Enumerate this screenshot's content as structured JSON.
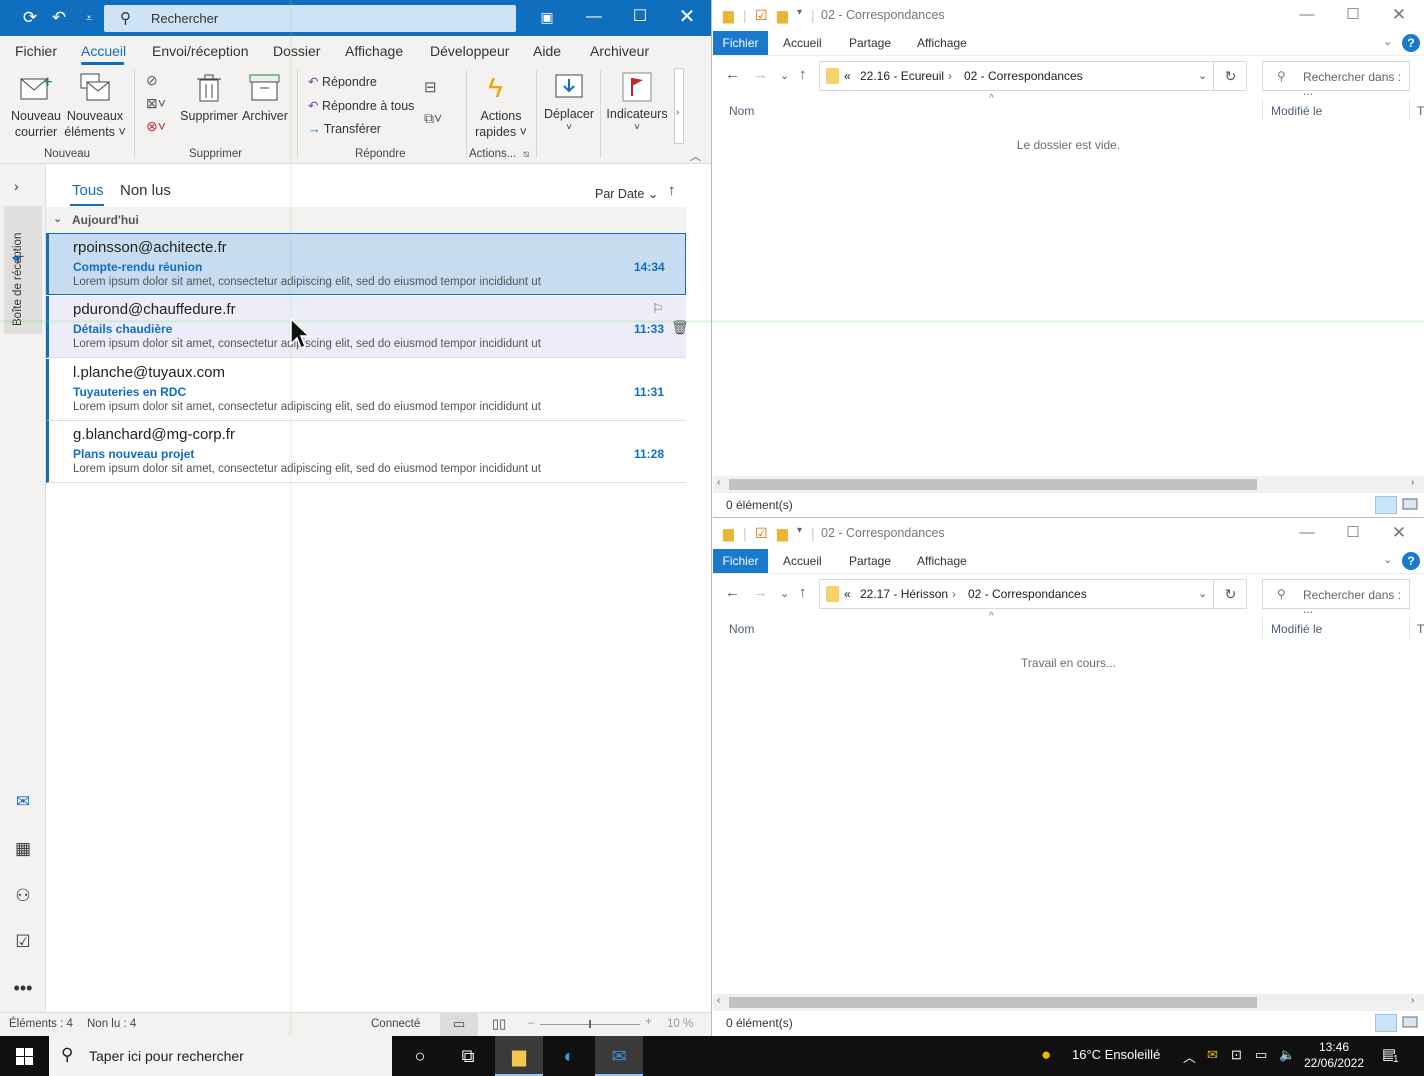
{
  "outlook": {
    "search_placeholder": "Rechercher",
    "menu": [
      "Fichier",
      "Accueil",
      "Envoi/réception",
      "Dossier",
      "Affichage",
      "Développeur",
      "Aide",
      "Archiveur"
    ],
    "ribbon": {
      "new_mail": [
        "Nouveau",
        "courrier"
      ],
      "new_items": [
        "Nouveaux",
        "éléments ˅"
      ],
      "delete": "Supprimer",
      "archive": "Archiver",
      "reply": "Répondre",
      "reply_all": "Répondre à tous",
      "forward": "Transférer",
      "quick_actions": [
        "Actions",
        "rapides ˅"
      ],
      "move": "Déplacer",
      "flags": "Indicateurs",
      "groups": [
        "Nouveau",
        "Supprimer",
        "Répondre",
        "Actions..."
      ]
    },
    "rail": {
      "inbox_label": "Boîte de réception",
      "inbox_count": "4"
    },
    "list": {
      "tab_all": "Tous",
      "tab_unread": "Non lus",
      "sort": "Par Date",
      "group": "Aujourd'hui",
      "messages": [
        {
          "from": "rpoinsson@achitecte.fr",
          "subject": "Compte-rendu réunion",
          "preview": "Lorem ipsum dolor sit amet, consectetur adipiscing elit, sed do eiusmod tempor incididunt ut",
          "time": "14:34"
        },
        {
          "from": "pdurond@chauffedure.fr",
          "subject": "Détails chaudière",
          "preview": "Lorem ipsum dolor sit amet, consectetur adipiscing elit, sed do eiusmod tempor incididunt ut",
          "time": "11:33"
        },
        {
          "from": "l.planche@tuyaux.com",
          "subject": "Tuyauteries en RDC",
          "preview": "Lorem ipsum dolor sit amet, consectetur adipiscing elit, sed do eiusmod tempor incididunt ut",
          "time": "11:31"
        },
        {
          "from": "g.blanchard@mg-corp.fr",
          "subject": "Plans nouveau projet",
          "preview": "Lorem ipsum dolor sit amet, consectetur adipiscing elit, sed do eiusmod tempor incididunt ut",
          "time": "11:28"
        }
      ]
    },
    "status": {
      "items": "Éléments : 4",
      "unread": "Non lu : 4",
      "connection": "Connecté",
      "zoom": "10 %"
    }
  },
  "explorer1": {
    "title": "02 - Correspondances",
    "tabs": [
      "Fichier",
      "Accueil",
      "Partage",
      "Affichage"
    ],
    "crumb1": "22.16 - Ecureuil",
    "crumb2": "02 - Correspondances",
    "search_placeholder": "Rechercher dans : ...",
    "col_name": "Nom",
    "col_modified": "Modifié le",
    "col_type": "T",
    "message": "Le dossier est vide.",
    "status": "0 élément(s)"
  },
  "explorer2": {
    "title": "02 - Correspondances",
    "tabs": [
      "Fichier",
      "Accueil",
      "Partage",
      "Affichage"
    ],
    "crumb1": "22.17 - Hérisson",
    "crumb2": "02 - Correspondances",
    "search_placeholder": "Rechercher dans : ...",
    "col_name": "Nom",
    "col_modified": "Modifié le",
    "col_type": "T",
    "message": "Travail en cours...",
    "status": "0 élément(s)"
  },
  "taskbar": {
    "search_placeholder": "Taper ici pour rechercher",
    "weather": "16°C Ensoleillé",
    "time": "13:46",
    "date": "22/06/2022",
    "notifications": "1"
  },
  "colors": {
    "outlook_blue": "#106ebe",
    "explorer_blue": "#1979ca",
    "taskbar": "#101010"
  }
}
